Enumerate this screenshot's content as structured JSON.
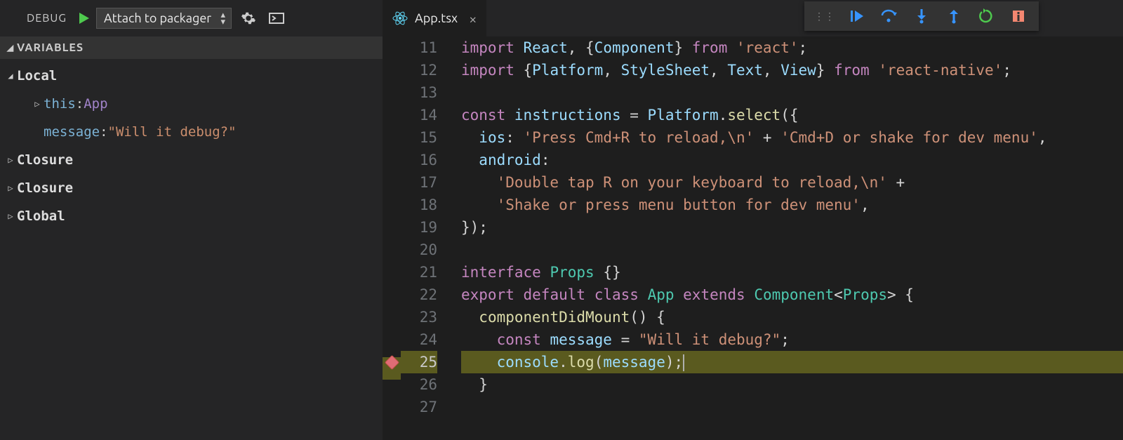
{
  "sidebar": {
    "title": "DEBUG",
    "config": "Attach to packager",
    "section": "VARIABLES",
    "scopes": {
      "local": "Local",
      "closure1": "Closure",
      "closure2": "Closure",
      "global": "Global"
    },
    "vars": {
      "this_name": "this",
      "this_colon": ": ",
      "this_type": "App",
      "msg_name": "message",
      "msg_colon": ": ",
      "msg_value": "\"Will it debug?\""
    }
  },
  "tab": {
    "filename": "App.tsx"
  },
  "code": {
    "lines": [
      {
        "n": 11,
        "tokens": [
          {
            "c": "c-kw",
            "t": "import"
          },
          {
            "c": "c-op",
            "t": " "
          },
          {
            "c": "c-id",
            "t": "React"
          },
          {
            "c": "c-pun",
            "t": ", {"
          },
          {
            "c": "c-id",
            "t": "Component"
          },
          {
            "c": "c-pun",
            "t": "} "
          },
          {
            "c": "c-kw",
            "t": "from"
          },
          {
            "c": "c-op",
            "t": " "
          },
          {
            "c": "c-str",
            "t": "'react'"
          },
          {
            "c": "c-pun",
            "t": ";"
          }
        ]
      },
      {
        "n": 12,
        "tokens": [
          {
            "c": "c-kw",
            "t": "import"
          },
          {
            "c": "c-op",
            "t": " {"
          },
          {
            "c": "c-id",
            "t": "Platform"
          },
          {
            "c": "c-pun",
            "t": ", "
          },
          {
            "c": "c-id",
            "t": "StyleSheet"
          },
          {
            "c": "c-pun",
            "t": ", "
          },
          {
            "c": "c-id",
            "t": "Text"
          },
          {
            "c": "c-pun",
            "t": ", "
          },
          {
            "c": "c-id",
            "t": "View"
          },
          {
            "c": "c-pun",
            "t": "} "
          },
          {
            "c": "c-kw",
            "t": "from"
          },
          {
            "c": "c-op",
            "t": " "
          },
          {
            "c": "c-str",
            "t": "'react-native'"
          },
          {
            "c": "c-pun",
            "t": ";"
          }
        ]
      },
      {
        "n": 13,
        "tokens": []
      },
      {
        "n": 14,
        "tokens": [
          {
            "c": "c-kw",
            "t": "const"
          },
          {
            "c": "c-op",
            "t": " "
          },
          {
            "c": "c-id",
            "t": "instructions"
          },
          {
            "c": "c-op",
            "t": " = "
          },
          {
            "c": "c-id",
            "t": "Platform"
          },
          {
            "c": "c-pun",
            "t": "."
          },
          {
            "c": "c-fn",
            "t": "select"
          },
          {
            "c": "c-pun",
            "t": "({"
          }
        ]
      },
      {
        "n": 15,
        "tokens": [
          {
            "c": "c-op",
            "t": "  "
          },
          {
            "c": "c-prop",
            "t": "ios"
          },
          {
            "c": "c-pun",
            "t": ": "
          },
          {
            "c": "c-str",
            "t": "'Press Cmd+R to reload,\\n'"
          },
          {
            "c": "c-op",
            "t": " + "
          },
          {
            "c": "c-str",
            "t": "'Cmd+D or shake for dev menu'"
          },
          {
            "c": "c-pun",
            "t": ","
          }
        ]
      },
      {
        "n": 16,
        "tokens": [
          {
            "c": "c-op",
            "t": "  "
          },
          {
            "c": "c-prop",
            "t": "android"
          },
          {
            "c": "c-pun",
            "t": ":"
          }
        ]
      },
      {
        "n": 17,
        "tokens": [
          {
            "c": "c-op",
            "t": "    "
          },
          {
            "c": "c-str",
            "t": "'Double tap R on your keyboard to reload,\\n'"
          },
          {
            "c": "c-op",
            "t": " +"
          }
        ]
      },
      {
        "n": 18,
        "tokens": [
          {
            "c": "c-op",
            "t": "    "
          },
          {
            "c": "c-str",
            "t": "'Shake or press menu button for dev menu'"
          },
          {
            "c": "c-pun",
            "t": ","
          }
        ]
      },
      {
        "n": 19,
        "tokens": [
          {
            "c": "c-pun",
            "t": "});"
          }
        ]
      },
      {
        "n": 20,
        "tokens": []
      },
      {
        "n": 21,
        "tokens": [
          {
            "c": "c-kw",
            "t": "interface"
          },
          {
            "c": "c-op",
            "t": " "
          },
          {
            "c": "c-type",
            "t": "Props"
          },
          {
            "c": "c-op",
            "t": " "
          },
          {
            "c": "c-pun",
            "t": "{}"
          }
        ]
      },
      {
        "n": 22,
        "tokens": [
          {
            "c": "c-kw",
            "t": "export"
          },
          {
            "c": "c-op",
            "t": " "
          },
          {
            "c": "c-kw",
            "t": "default"
          },
          {
            "c": "c-op",
            "t": " "
          },
          {
            "c": "c-kw",
            "t": "class"
          },
          {
            "c": "c-op",
            "t": " "
          },
          {
            "c": "c-type",
            "t": "App"
          },
          {
            "c": "c-op",
            "t": " "
          },
          {
            "c": "c-kw",
            "t": "extends"
          },
          {
            "c": "c-op",
            "t": " "
          },
          {
            "c": "c-type",
            "t": "Component"
          },
          {
            "c": "c-pun",
            "t": "<"
          },
          {
            "c": "c-type",
            "t": "Props"
          },
          {
            "c": "c-pun",
            "t": "> {"
          }
        ]
      },
      {
        "n": 23,
        "tokens": [
          {
            "c": "c-op",
            "t": "  "
          },
          {
            "c": "c-fn",
            "t": "componentDidMount"
          },
          {
            "c": "c-pun",
            "t": "() {"
          }
        ]
      },
      {
        "n": 24,
        "tokens": [
          {
            "c": "c-op",
            "t": "    "
          },
          {
            "c": "c-kw",
            "t": "const"
          },
          {
            "c": "c-op",
            "t": " "
          },
          {
            "c": "c-id",
            "t": "message"
          },
          {
            "c": "c-op",
            "t": " = "
          },
          {
            "c": "c-str",
            "t": "\"Will it debug?\""
          },
          {
            "c": "c-pun",
            "t": ";"
          }
        ]
      },
      {
        "n": 25,
        "hl": true,
        "bp": true,
        "tokens": [
          {
            "c": "c-op",
            "t": "    "
          },
          {
            "c": "c-id",
            "t": "console"
          },
          {
            "c": "c-pun",
            "t": "."
          },
          {
            "c": "c-fn",
            "t": "log"
          },
          {
            "c": "c-pun",
            "t": "("
          },
          {
            "c": "c-id",
            "t": "message"
          },
          {
            "c": "c-pun",
            "t": ");"
          }
        ],
        "cursor": true
      },
      {
        "n": 26,
        "tokens": [
          {
            "c": "c-op",
            "t": "  "
          },
          {
            "c": "c-pun",
            "t": "}"
          }
        ]
      },
      {
        "n": 27,
        "tokens": []
      }
    ]
  }
}
